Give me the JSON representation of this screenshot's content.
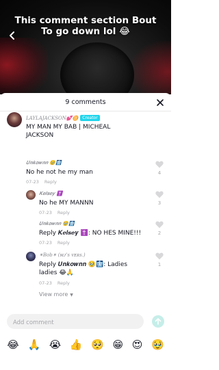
{
  "video": {
    "caption_line1": "This comment section Bout",
    "caption_line2": "To go down lol 😂"
  },
  "sheet": {
    "count_label": "9 comments"
  },
  "comments": {
    "main": {
      "username": "LAYLAJACKSON💕♊",
      "badge": "Creator",
      "text": "MY MAN MY BAB | MICHEAL JACKSON"
    },
    "c1": {
      "username": "𝑼𝒏𝒌𝒐𝒘𝒏𝒏 🥹🩻",
      "text": "No he not he my man",
      "date": "07-23",
      "reply": "Reply",
      "likes": "4"
    },
    "c2": {
      "username": "𝑲𝒆𝒍𝒔𝒆𝒚 ✝️",
      "text": "No he MY MANNN",
      "date": "07-23",
      "reply": "Reply",
      "likes": "3"
    },
    "c3": {
      "username": "𝑼𝒏𝒌𝒐𝒘𝒏𝒏 🥹🩻",
      "text": "Reply 𝑲𝒆𝒍𝒔𝒆𝒚 ✝️: NO HES MINE!!!",
      "date": "07-23",
      "reply": "Reply",
      "likes": "2"
    },
    "c4": {
      "username": "✶𝐵𝑜𝑏✶ (ᴍᴊ's ᴠᴇʀs.)",
      "text": "Reply 𝑼𝒏𝒌𝒐𝒘𝒏𝒏 🥹🩻: Ladies ladies 😂🙏",
      "date": "07-23",
      "reply": "Reply",
      "likes": "1"
    }
  },
  "view_more": "View more",
  "input": {
    "placeholder": "Add comment"
  },
  "emojis": [
    "😂",
    "🙏",
    "😭",
    "👍",
    "🥺",
    "😁",
    "😍",
    "🥹"
  ],
  "colors": {
    "creator_badge": "#20d5ec",
    "send_button": "#c6eee9"
  }
}
